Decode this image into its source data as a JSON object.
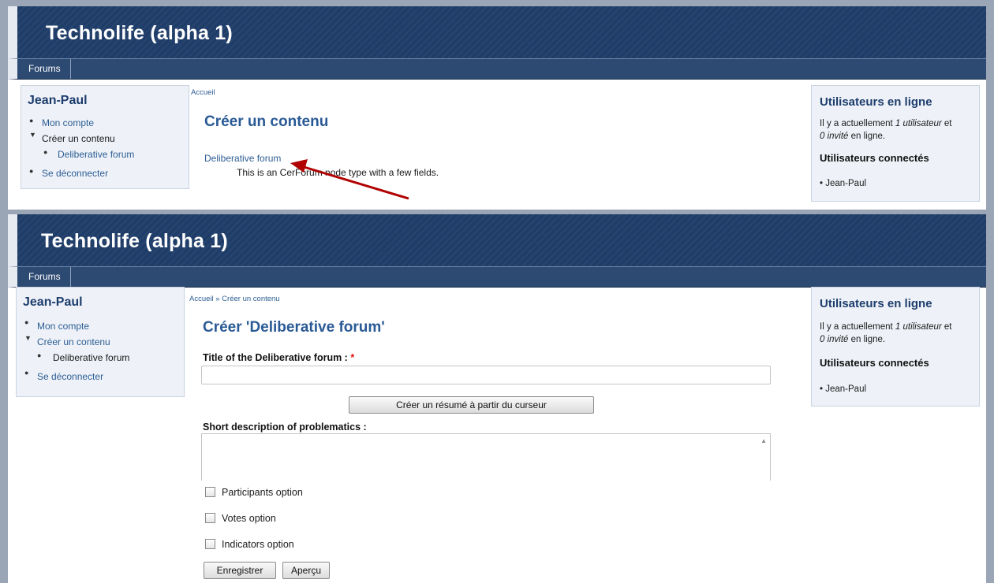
{
  "site_title": "Technolife (alpha 1)",
  "nav": {
    "forums": "Forums"
  },
  "sidebar": {
    "user": "Jean-Paul",
    "items": [
      "Mon compte",
      "Créer un contenu",
      "Deliberative forum",
      "Se déconnecter"
    ]
  },
  "online": {
    "title": "Utilisateurs en ligne",
    "text_prefix": "Il y a actuellement ",
    "users_count": "1 utilisateur",
    "text_mid": " et ",
    "guests_count": "0 invité",
    "text_suffix": " en ligne.",
    "connected_title": "Utilisateurs connectés",
    "connected_user": "Jean-Paul"
  },
  "screen1": {
    "breadcrumb": "Accueil",
    "title": "Créer un contenu",
    "content_type_link": "Deliberative forum",
    "content_type_desc": "This is an CerForum node type with a few fields.",
    "arrow_color": "#b00000"
  },
  "screen2": {
    "breadcrumb": "Accueil » Créer un contenu",
    "title": "Créer 'Deliberative forum'",
    "title_label": "Title of the Deliberative forum :",
    "required_mark": "*",
    "summary_button": "Créer un résumé à partir du curseur",
    "short_desc_label": "Short description of problematics :",
    "options": [
      "Participants option",
      "Votes option",
      "Indicators option"
    ],
    "save_button": "Enregistrer",
    "preview_button": "Aperçu"
  },
  "colors": {
    "banner": "#1f3d69",
    "navbar": "#2d4a72",
    "link": "#2d5d93",
    "heading": "#2a5a95"
  }
}
